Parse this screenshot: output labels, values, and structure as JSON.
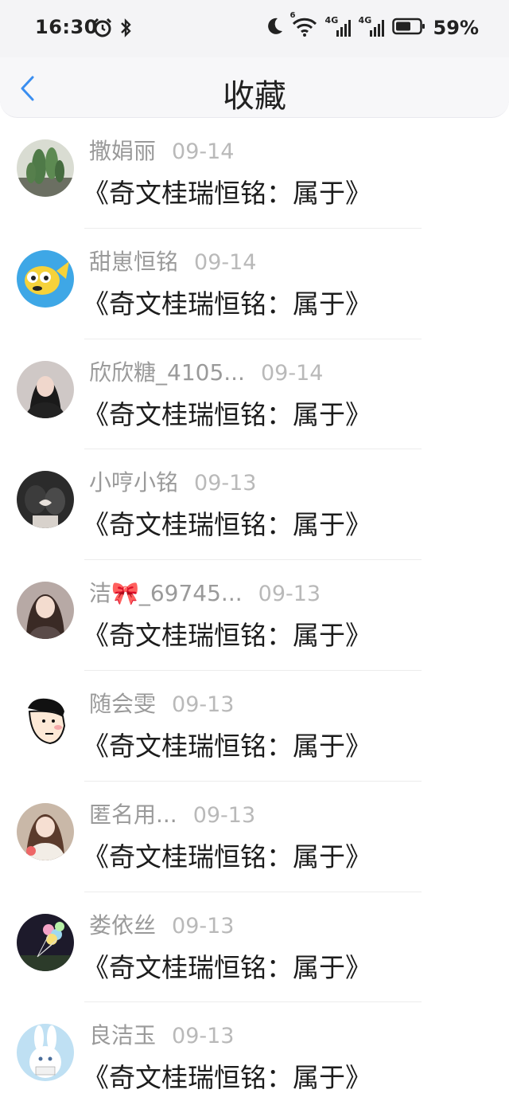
{
  "status_bar": {
    "time": "16:30",
    "battery_pct": "59%",
    "net1": "4G",
    "net2": "4G",
    "wifi_tag": "6",
    "icons": [
      "alarm-icon",
      "bluetooth-icon",
      "moon-icon",
      "wifi-icon",
      "signal-icon",
      "battery-icon"
    ]
  },
  "nav": {
    "title": "收藏",
    "back_icon": "chevron-left-icon",
    "accent": "#3a8ef0"
  },
  "items": [
    {
      "name": "撒娟丽",
      "date": "09-14",
      "title": "《奇文桂瑞恒铭：属于》",
      "avatar": "cactus"
    },
    {
      "name": "甜崽恒铭",
      "date": "09-14",
      "title": "《奇文桂瑞恒铭：属于》",
      "avatar": "yellow-fish"
    },
    {
      "name": "欣欣糖_4105...",
      "date": "09-14",
      "title": "《奇文桂瑞恒铭：属于》",
      "avatar": "girl-dark"
    },
    {
      "name": "小哼小铭",
      "date": "09-13",
      "title": "《奇文桂瑞恒铭：属于》",
      "avatar": "couple-hands"
    },
    {
      "name": "洁🎀_69745...",
      "date": "09-13",
      "title": "《奇文桂瑞恒铭：属于》",
      "avatar": "girl-happy"
    },
    {
      "name": "随会雯",
      "date": "09-13",
      "title": "《奇文桂瑞恒铭：属于》",
      "avatar": "cartoon-face"
    },
    {
      "name": "匿名用...",
      "date": "09-13",
      "title": "《奇文桂瑞恒铭：属于》",
      "avatar": "girl-sweater"
    },
    {
      "name": "娄依丝",
      "date": "09-13",
      "title": "《奇文桂瑞恒铭：属于》",
      "avatar": "balloons"
    },
    {
      "name": "良洁玉",
      "date": "09-13",
      "title": "《奇文桂瑞恒铭：属于》",
      "avatar": "white-bunny"
    }
  ]
}
